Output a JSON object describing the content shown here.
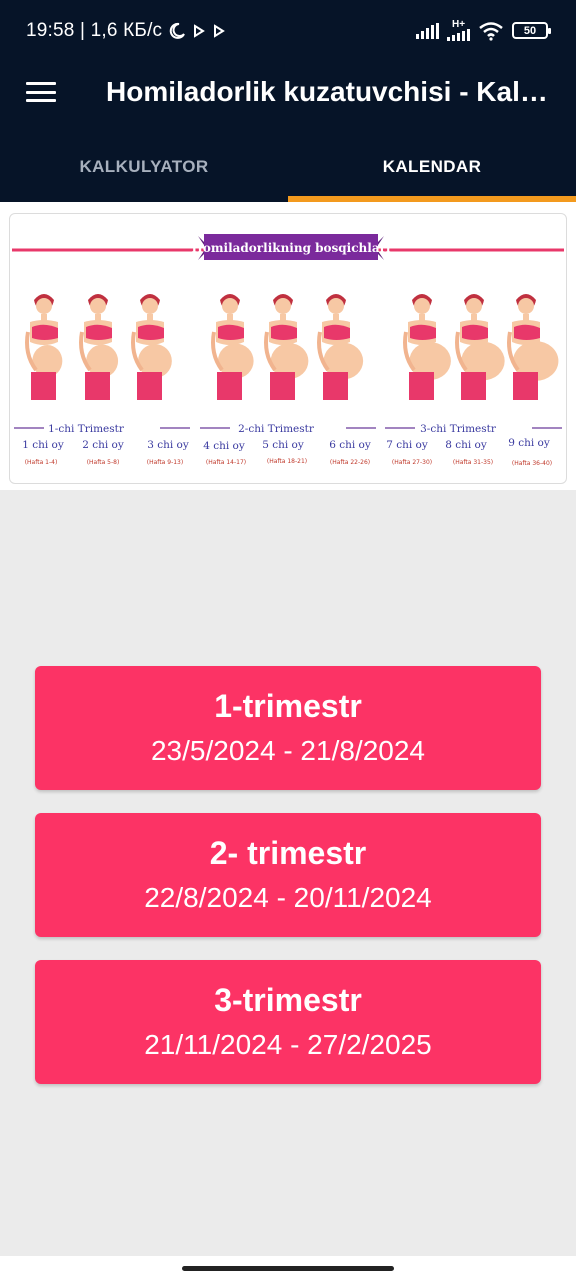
{
  "status_bar": {
    "time_speed": "19:58 | 1,6 КБ/с",
    "network_type": "H+",
    "battery": "50",
    "icons": [
      "moon-icon",
      "play-icon",
      "play-icon",
      "signal-icon",
      "signal-icon",
      "wifi-icon",
      "battery-icon"
    ]
  },
  "app_bar": {
    "menu_icon": "hamburger-menu-icon",
    "title": "Homiladorlik kuzatuvchisi - Kalkulyator"
  },
  "tabs": [
    {
      "label": "KALKULYATOR",
      "active": false
    },
    {
      "label": "KALENDAR",
      "active": true
    }
  ],
  "illustration": {
    "banner": "Homiladorlikning bosqichlari",
    "trimesters": [
      "1-chi Trimestr",
      "2-chi Trimestr",
      "3-chi Trimestr"
    ],
    "months": [
      {
        "label": "1 chi oy",
        "weeks": "(Hafta 1-4)"
      },
      {
        "label": "2 chi oy",
        "weeks": "(Hafta 5-8)"
      },
      {
        "label": "3 chi oy",
        "weeks": "(Hafta 9-13)"
      },
      {
        "label": "4 chi oy",
        "weeks": "(Hafta 14-17)"
      },
      {
        "label": "5 chi oy",
        "weeks": "(Hafta 18-21)"
      },
      {
        "label": "6 chi oy",
        "weeks": "(Hafta 22-26)"
      },
      {
        "label": "7 chi oy",
        "weeks": "(Hafta 27-30)"
      },
      {
        "label": "8 chi oy",
        "weeks": "(Hafta 31-35)"
      },
      {
        "label": "9 chi oy",
        "weeks": "(Hafta 36-40)"
      }
    ]
  },
  "trimester_cards": [
    {
      "name": "1-trimestr",
      "range": "23/5/2024 - 21/8/2024"
    },
    {
      "name": "2- trimestr",
      "range": "22/8/2024 - 20/11/2024"
    },
    {
      "name": "3-trimestr",
      "range": "21/11/2024 - 27/2/2025"
    }
  ],
  "colors": {
    "app_bar": "#061428",
    "tab_indicator": "#f39a1e",
    "card": "#fc3365",
    "background": "#ebebeb",
    "illustration_accent": "#e8386a",
    "banner": "#7b2a9c"
  }
}
